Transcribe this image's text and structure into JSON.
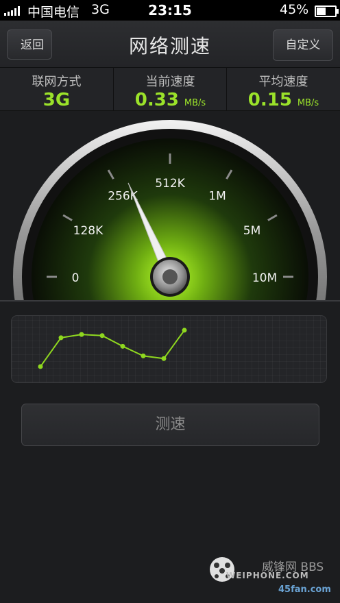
{
  "status_bar": {
    "carrier": "中国电信",
    "network": "3G",
    "time": "23:15",
    "battery": "45%",
    "battery_level": 0.45
  },
  "header": {
    "back_label": "返回",
    "title": "网络测速",
    "custom_label": "自定义"
  },
  "stats": [
    {
      "label": "联网方式",
      "value": "3G",
      "unit": ""
    },
    {
      "label": "当前速度",
      "value": "0.33",
      "unit": "MB/s"
    },
    {
      "label": "平均速度",
      "value": "0.15",
      "unit": "MB/s"
    }
  ],
  "gauge": {
    "tick_labels": [
      "0",
      "128K",
      "256K",
      "512K",
      "1M",
      "5M",
      "10M"
    ],
    "needle_tick_position": 2.2,
    "accent_color": "#9be22a"
  },
  "speed_graph": {
    "points": [
      0.18,
      0.72,
      0.78,
      0.76,
      0.56,
      0.38,
      0.33,
      0.86
    ],
    "line_color": "#8fd81f"
  },
  "test_button": {
    "label": "测速"
  },
  "watermark": {
    "line1": "威锋网 BBS",
    "line2": "WEIPHONE.COM",
    "line3": "45fan.com"
  }
}
